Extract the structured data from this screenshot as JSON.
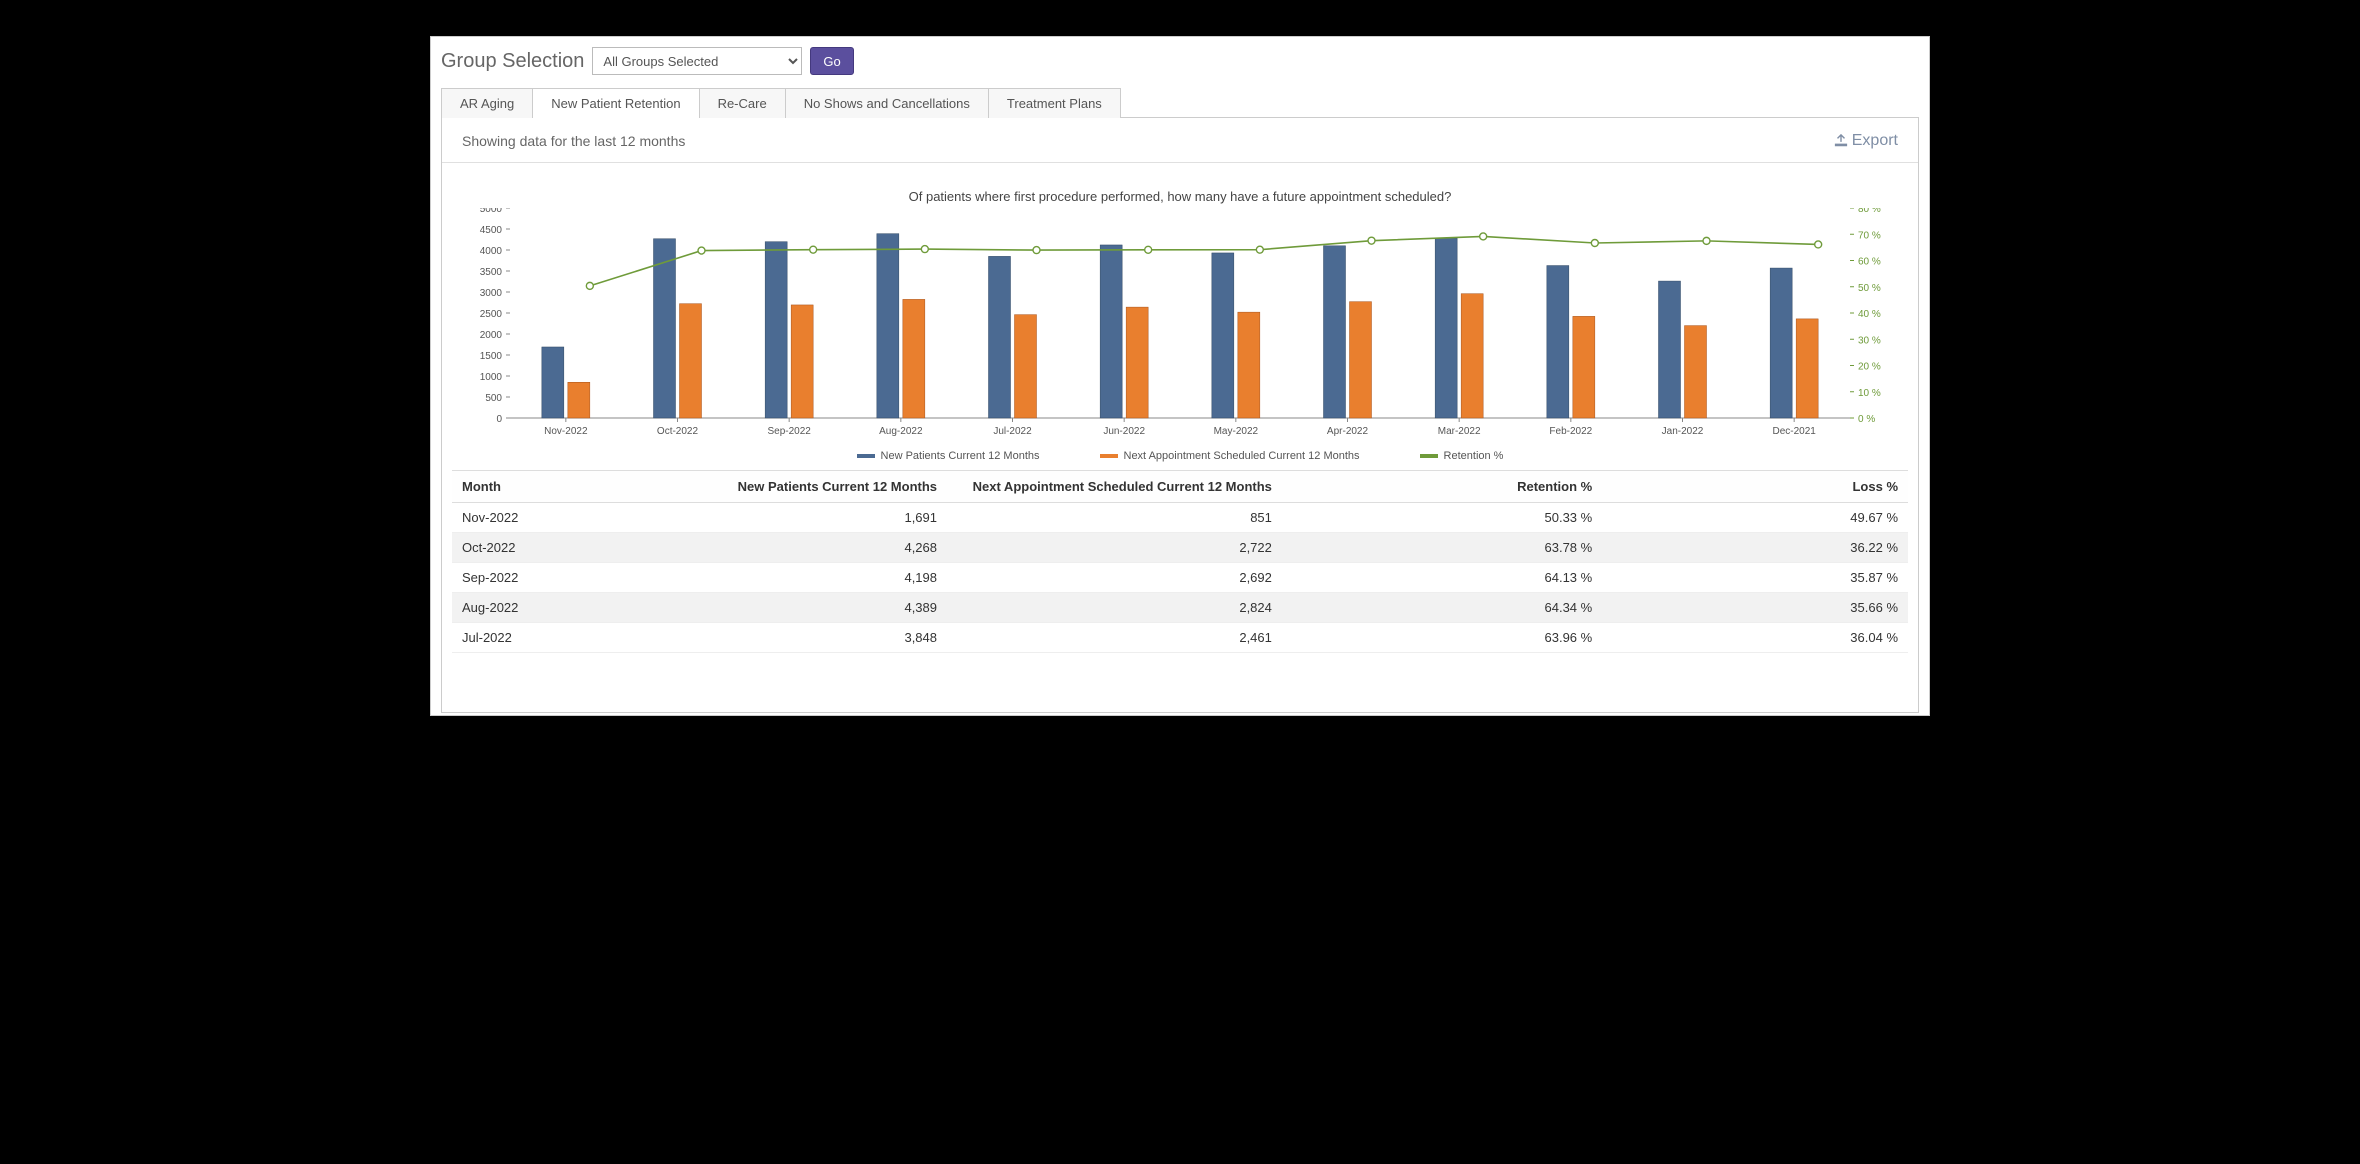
{
  "topbar": {
    "group_label": "Group Selection",
    "select_value": "All Groups Selected",
    "go_label": "Go"
  },
  "tabs": [
    {
      "label": "AR Aging",
      "active": false
    },
    {
      "label": "New Patient Retention",
      "active": true
    },
    {
      "label": "Re-Care",
      "active": false
    },
    {
      "label": "No Shows and Cancellations",
      "active": false
    },
    {
      "label": "Treatment Plans",
      "active": false
    }
  ],
  "panel": {
    "subtitle": "Showing data for the last 12 months",
    "export_label": "Export"
  },
  "chart_data": {
    "type": "bar+line",
    "title": "Of patients where first procedure performed, how many have a future appointment scheduled?",
    "categories": [
      "Nov-2022",
      "Oct-2022",
      "Sep-2022",
      "Aug-2022",
      "Jul-2022",
      "Jun-2022",
      "May-2022",
      "Apr-2022",
      "Mar-2022",
      "Feb-2022",
      "Jan-2022",
      "Dec-2021"
    ],
    "y_left": {
      "min": 0,
      "max": 5000,
      "step": 500,
      "label": ""
    },
    "y_right": {
      "min": 0,
      "max": 80,
      "step": 10,
      "label": "%"
    },
    "series": [
      {
        "name": "New Patients Current 12 Months",
        "type": "bar",
        "color": "#4b6a92",
        "values": [
          1691,
          4268,
          4198,
          4389,
          3848,
          4120,
          3930,
          4100,
          4280,
          3630,
          3260,
          3570
        ]
      },
      {
        "name": "Next Appointment Scheduled Current 12 Months",
        "type": "bar",
        "color": "#e97f2e",
        "values": [
          851,
          2722,
          2692,
          2824,
          2461,
          2640,
          2520,
          2770,
          2960,
          2420,
          2200,
          2360
        ]
      },
      {
        "name": "Retention %",
        "type": "line",
        "color": "#6f9b3a",
        "axis": "right",
        "values": [
          50.33,
          63.78,
          64.13,
          64.34,
          63.96,
          64.08,
          64.12,
          67.56,
          69.16,
          66.67,
          67.48,
          66.11
        ]
      }
    ],
    "legend": [
      "New Patients Current 12 Months",
      "Next Appointment Scheduled Current 12 Months",
      "Retention %"
    ]
  },
  "table": {
    "headers": [
      "Month",
      "New Patients Current 12 Months",
      "Next Appointment Scheduled Current 12 Months",
      "Retention %",
      "Loss %"
    ],
    "rows": [
      {
        "month": "Nov-2022",
        "np": "1,691",
        "na": "851",
        "ret": "50.33 %",
        "loss": "49.67 %"
      },
      {
        "month": "Oct-2022",
        "np": "4,268",
        "na": "2,722",
        "ret": "63.78 %",
        "loss": "36.22 %"
      },
      {
        "month": "Sep-2022",
        "np": "4,198",
        "na": "2,692",
        "ret": "64.13 %",
        "loss": "35.87 %"
      },
      {
        "month": "Aug-2022",
        "np": "4,389",
        "na": "2,824",
        "ret": "64.34 %",
        "loss": "35.66 %"
      },
      {
        "month": "Jul-2022",
        "np": "3,848",
        "na": "2,461",
        "ret": "63.96 %",
        "loss": "36.04 %"
      }
    ]
  },
  "colors": {
    "bar1": "#4b6a92",
    "bar2": "#e97f2e",
    "line": "#6f9b3a"
  }
}
